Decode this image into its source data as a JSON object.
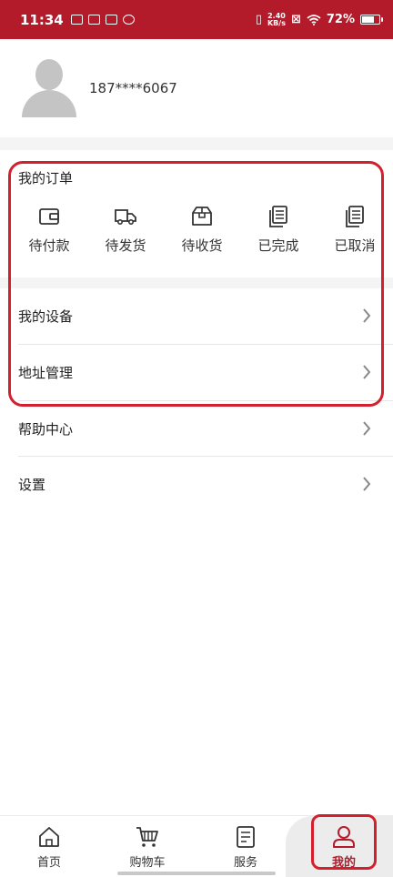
{
  "status_bar": {
    "time": "11:34",
    "net_speed_top": "2.40",
    "net_speed_bottom": "KB/s",
    "battery": "72%",
    "battery_level": 0.72
  },
  "profile": {
    "phone": "187****6067"
  },
  "orders": {
    "title": "我的订单",
    "items": [
      {
        "label": "待付款",
        "icon": "wallet-icon"
      },
      {
        "label": "待发货",
        "icon": "truck-icon"
      },
      {
        "label": "待收货",
        "icon": "box-icon"
      },
      {
        "label": "已完成",
        "icon": "document-icon"
      },
      {
        "label": "已取消",
        "icon": "document-icon"
      }
    ]
  },
  "menu": {
    "items": [
      {
        "label": "我的设备"
      },
      {
        "label": "地址管理"
      },
      {
        "label": "帮助中心"
      },
      {
        "label": "设置"
      }
    ]
  },
  "tabbar": {
    "items": [
      {
        "label": "首页",
        "icon": "home-icon"
      },
      {
        "label": "购物车",
        "icon": "cart-icon"
      },
      {
        "label": "服务",
        "icon": "service-icon"
      },
      {
        "label": "我的",
        "icon": "user-icon"
      }
    ],
    "active": "我的"
  },
  "colors": {
    "brand": "#b31b2b",
    "highlight": "#d2202e"
  }
}
